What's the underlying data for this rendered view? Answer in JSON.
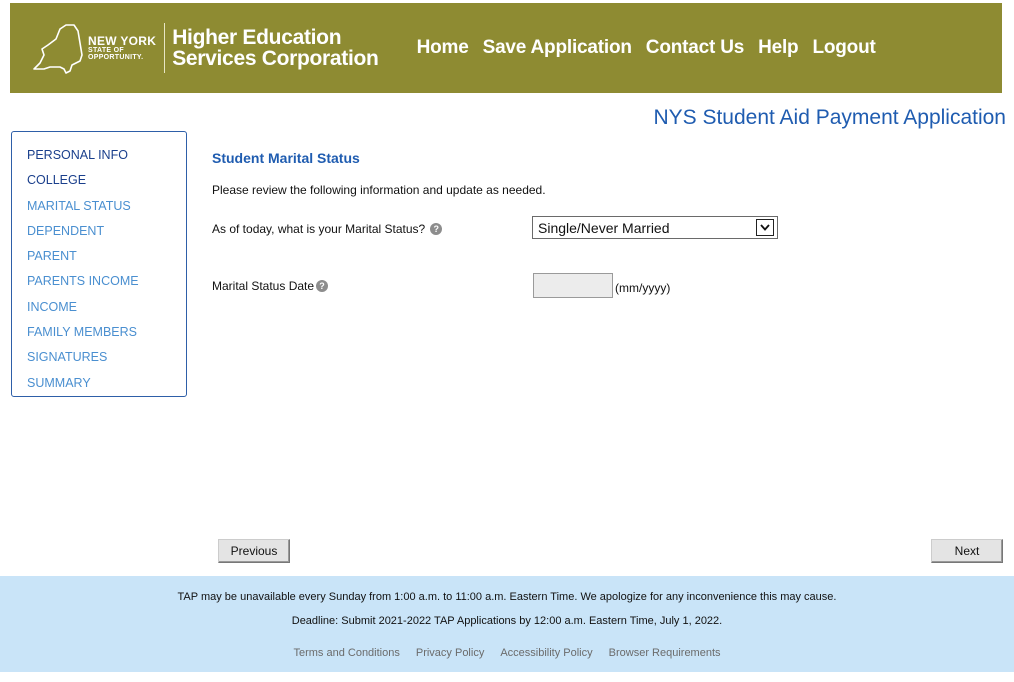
{
  "header": {
    "logo": {
      "line1": "NEW YORK",
      "line2": "STATE OF",
      "line3": "OPPORTUNITY."
    },
    "org_name_line1": "Higher Education",
    "org_name_line2": "Services Corporation",
    "nav": [
      "Home",
      "Save Application",
      "Contact Us",
      "Help",
      "Logout"
    ],
    "color": "#8e8b32"
  },
  "app_title": "NYS Student Aid Payment Application",
  "sidebar": {
    "items": [
      {
        "label": "PERSONAL INFO",
        "state": "done"
      },
      {
        "label": "COLLEGE",
        "state": "done"
      },
      {
        "label": "MARITAL STATUS",
        "state": "pending"
      },
      {
        "label": "DEPENDENT",
        "state": "pending"
      },
      {
        "label": "PARENT",
        "state": "pending"
      },
      {
        "label": "PARENTS INCOME",
        "state": "pending"
      },
      {
        "label": "INCOME",
        "state": "pending"
      },
      {
        "label": "FAMILY MEMBERS",
        "state": "pending"
      },
      {
        "label": "SIGNATURES",
        "state": "pending"
      },
      {
        "label": "SUMMARY",
        "state": "pending"
      }
    ]
  },
  "form": {
    "section_title": "Student Marital Status",
    "instructions": "Please review the following information and update as needed.",
    "marital_status_question": "As of today, what is your Marital Status?",
    "marital_status_value": "Single/Never Married",
    "marital_date_label": "Marital Status Date",
    "marital_date_value": "",
    "marital_date_format": "(mm/yyyy)"
  },
  "buttons": {
    "previous": "Previous",
    "next": "Next"
  },
  "footer": {
    "notice": "TAP may be unavailable every Sunday from 1:00 a.m. to 11:00 a.m. Eastern Time. We apologize for any inconvenience this may cause.",
    "deadline": "Deadline: Submit 2021-2022 TAP Applications by 12:00 a.m. Eastern Time, July 1, 2022.",
    "links": [
      "Terms and Conditions",
      "Privacy Policy",
      "Accessibility Policy",
      "Browser Requirements"
    ]
  },
  "icons": {
    "help": "help-question-icon",
    "select_arrow": "chevron-down-icon",
    "logo": "new-york-state-map-icon"
  }
}
